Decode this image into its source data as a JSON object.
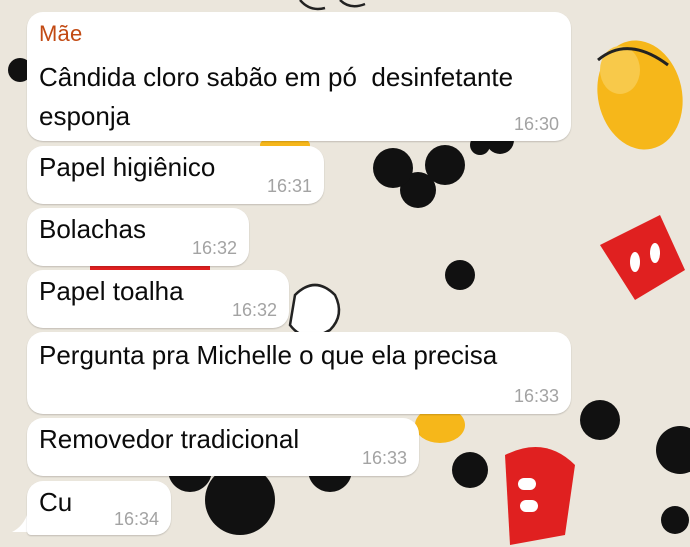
{
  "contact_name": "Mãe",
  "colors": {
    "sender_name": "#c24a13",
    "bubble": "#ffffff",
    "timestamp": "#a3a3a3",
    "wallpaper": "#ebe6dc"
  },
  "messages": [
    {
      "text": "Cândida cloro sabão em pó  desinfetante\nesponja",
      "time": "16:30"
    },
    {
      "text": "Papel higiênico",
      "time": "16:31"
    },
    {
      "text": "Bolachas",
      "time": "16:32"
    },
    {
      "text": "Papel toalha",
      "time": "16:32"
    },
    {
      "text": "Pergunta pra Michelle o que ela precisa",
      "time": "16:33"
    },
    {
      "text": "Removedor tradicional",
      "time": "16:33"
    },
    {
      "text": "Cu",
      "time": "16:34"
    }
  ]
}
